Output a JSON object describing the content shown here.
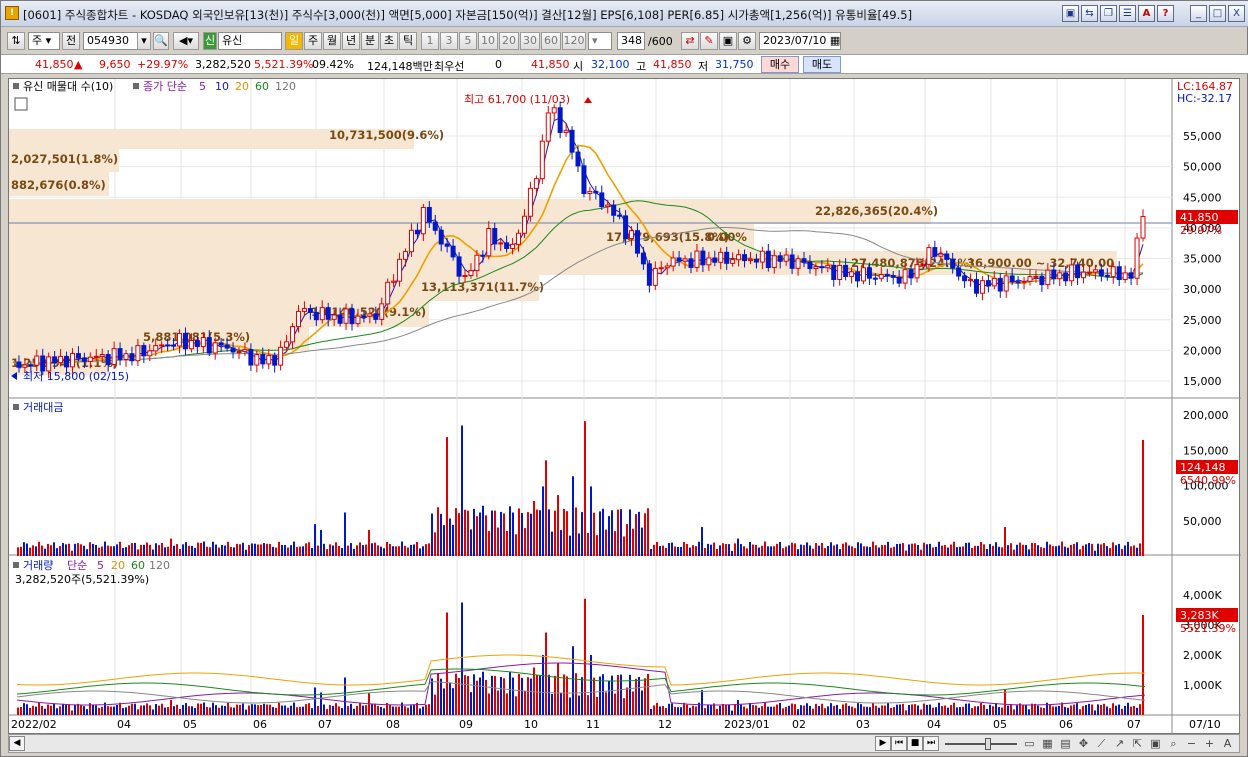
{
  "window": {
    "title": "[0601] 주식종합차트 - KOSDAQ 외국인보유[13(천)] 주식수[3,000(천)] 액면[5,000] 자본금[150(억)] 결산[12월] EPS[6,108] PER[6.85] 시가총액[1,256(억)] 유통비율[49.5]",
    "title_buttons": [
      "▣",
      "⇆",
      "❐",
      "☰",
      "A",
      "?"
    ],
    "win_buttons": [
      "_",
      "□",
      "X"
    ]
  },
  "toolbar": {
    "market": "주",
    "prev_label": "전",
    "code": "054930",
    "stock_tag": "신",
    "stock_name": "유신",
    "period_buttons": [
      "일",
      "주",
      "월",
      "년",
      "분",
      "초",
      "틱"
    ],
    "interval_buttons": [
      "1",
      "3",
      "5",
      "10",
      "20",
      "30",
      "60",
      "120"
    ],
    "count": "348",
    "count_total": "/600",
    "date": "2023/07/10"
  },
  "quote": {
    "price": "41,850",
    "change": "9,650",
    "change_pct": "+29.97%",
    "volume": "3,282,520",
    "volume_pct": "5,521.39%",
    "turnover": "09.42%",
    "amount": "124,148백만",
    "label_prior": "최우선",
    "prior_value": "0",
    "price2": "41,850",
    "open_label": "시",
    "open": "32,100",
    "high_label": "고",
    "high": "41,850",
    "low_label": "저",
    "low": "31,750",
    "buy_label": "매수",
    "sell_label": "매도"
  },
  "price_panel": {
    "legend_title": "유신 매물대 수(10)",
    "ma_label": "종가 단순",
    "ma_periods": [
      "5",
      "10",
      "20",
      "60",
      "120"
    ],
    "lc": "LC:164.87",
    "hc": "HC:-32.17",
    "high_note": "최고 61,700 (11/03)",
    "low_note": "최저 15,800 (02/15)",
    "current_price_tag": "41,850",
    "current_pct_tag": "29.97%",
    "y_ticks": [
      "55,000",
      "50,000",
      "45,000",
      "40,000",
      "35,000",
      "30,000",
      "25,000",
      "20,000",
      "15,000"
    ],
    "volume_profile_labels": [
      "10,731,500(9.6%)",
      "2,027,501(1.8%)",
      "882,676(0.8%)",
      "22,826,365(20.4%)",
      "17,679,693(15.8%)",
      "27,480,878(24.5%)",
      "13,113,371(11.7%)",
      "10,140,520(9.1%)",
      "5,881,081(5.3%)",
      "1,252,947(1.1%)",
      "36,900.00 ~ 32,740.00",
      "0.00%"
    ]
  },
  "amount_panel": {
    "legend": "거래대금",
    "y_ticks": [
      "200,000",
      "150,000",
      "100,000",
      "50,000"
    ],
    "tag_value": "124,148",
    "tag_pct": "6540.99%"
  },
  "volume_panel": {
    "legend": "거래량",
    "ma_label": "단순",
    "ma_periods": [
      "5",
      "20",
      "60",
      "120"
    ],
    "value_note": "3,282,520주(5,521.39%)",
    "y_ticks": [
      "4,000K",
      "3,000K",
      "2,000K",
      "1,000K"
    ],
    "tag_value": "3,283K",
    "tag_pct": "5521.39%"
  },
  "x_axis": [
    "2022/02",
    "04",
    "05",
    "06",
    "07",
    "08",
    "09",
    "10",
    "11",
    "12",
    "2023/01",
    "02",
    "03",
    "04",
    "05",
    "06",
    "07",
    "07/10"
  ],
  "colors": {
    "up": "#e00000",
    "down": "#0018c8",
    "ma5": "#8a1aa8",
    "ma10": "#1a1ab8",
    "ma20": "#f0a000",
    "ma60": "#1a8a1a",
    "ma120": "#888888",
    "profile": "#f6e6d2"
  }
}
